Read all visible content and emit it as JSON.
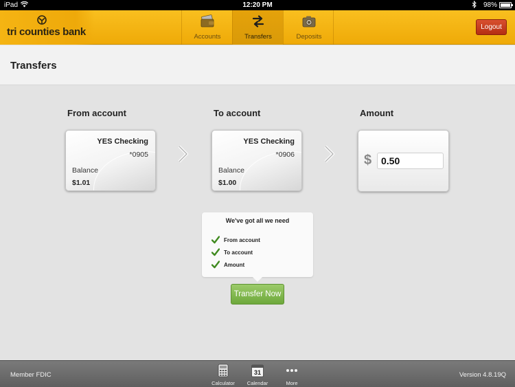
{
  "status_bar": {
    "carrier": "iPad",
    "time": "12:20 PM",
    "battery_text": "98%",
    "battery_level": 0.98
  },
  "brand": {
    "name": "tri counties bank"
  },
  "nav": {
    "tabs": [
      {
        "label": "Accounts",
        "icon": "wallet-icon",
        "active": false
      },
      {
        "label": "Transfers",
        "icon": "transfer-arrows-icon",
        "active": true
      },
      {
        "label": "Deposits",
        "icon": "camera-icon",
        "active": false
      }
    ],
    "logout_label": "Logout"
  },
  "page": {
    "title": "Transfers"
  },
  "from_account": {
    "section_label": "From account",
    "name": "YES Checking",
    "number": "*0905",
    "balance_label": "Balance",
    "balance": "$1.01"
  },
  "to_account": {
    "section_label": "To account",
    "name": "YES Checking",
    "number": "*0906",
    "balance_label": "Balance",
    "balance": "$1.00"
  },
  "amount": {
    "section_label": "Amount",
    "currency_symbol": "$",
    "value": "0.50"
  },
  "checklist": {
    "title": "We've got all we need",
    "items": [
      "From account",
      "To account",
      "Amount"
    ]
  },
  "actions": {
    "transfer_label": "Transfer Now"
  },
  "footer": {
    "left_text": "Member FDIC",
    "right_text": "Version 4.8.19Q",
    "calendar_day": "31",
    "items": [
      {
        "label": "Calculator",
        "icon": "calculator-icon"
      },
      {
        "label": "Calendar",
        "icon": "calendar-icon"
      },
      {
        "label": "More",
        "icon": "more-dots-icon"
      }
    ]
  },
  "colors": {
    "header": "#f5b413",
    "logout": "#c13a1c",
    "transfer_button": "#7fb64b",
    "check": "#3f8a1f",
    "footer": "#6b6b6b"
  }
}
